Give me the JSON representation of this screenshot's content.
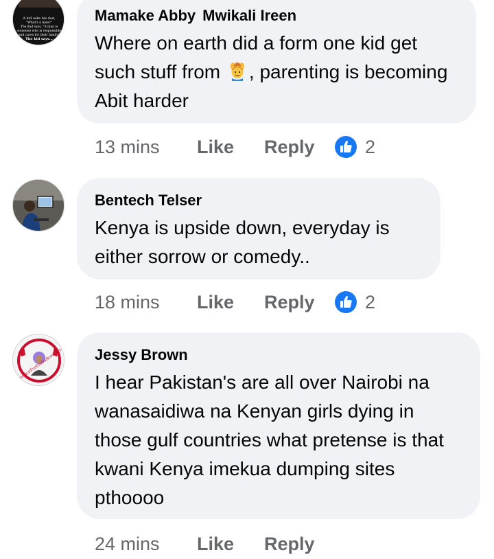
{
  "colors": {
    "bubble": "#f0f2f5",
    "meta_text": "#65676b",
    "like_blue": "#1877f2"
  },
  "comments": [
    {
      "author": "Mamake Abby",
      "tag": "Mwikali Ireen",
      "avatar_text": [
        "A kid asks his dad,",
        "\"What's a man?\"",
        "The dad says, \"A man is",
        "someone who is responsible",
        "and cares for their family\"",
        "The kid says..."
      ],
      "text_before_emoji": "Where on earth did a form one kid get such stuff from ",
      "emoji": "person-gesturing-ok-emoji",
      "text_after_emoji": ", parenting is becoming Abit harder",
      "time": "13 mins",
      "like_label": "Like",
      "reply_label": "Reply",
      "reaction_icon": "like-thumb-icon",
      "reaction_count": "2"
    },
    {
      "author": "Bentech Telser",
      "text": "Kenya is upside down, everyday is either sorrow or comedy..",
      "time": "18 mins",
      "like_label": "Like",
      "reply_label": "Reply",
      "reaction_icon": "like-thumb-icon",
      "reaction_count": "2"
    },
    {
      "author": "Jessy Brown",
      "avatar_text": "#JusticeForEmbuBrothers",
      "text": "I hear Pakistan's are all over Nairobi na wanasaidiwa na Kenyan girls dying in those gulf countries what pretense is that kwani Kenya imekua dumping sites pthoooo",
      "time": "24 mins",
      "like_label": "Like",
      "reply_label": "Reply"
    }
  ]
}
